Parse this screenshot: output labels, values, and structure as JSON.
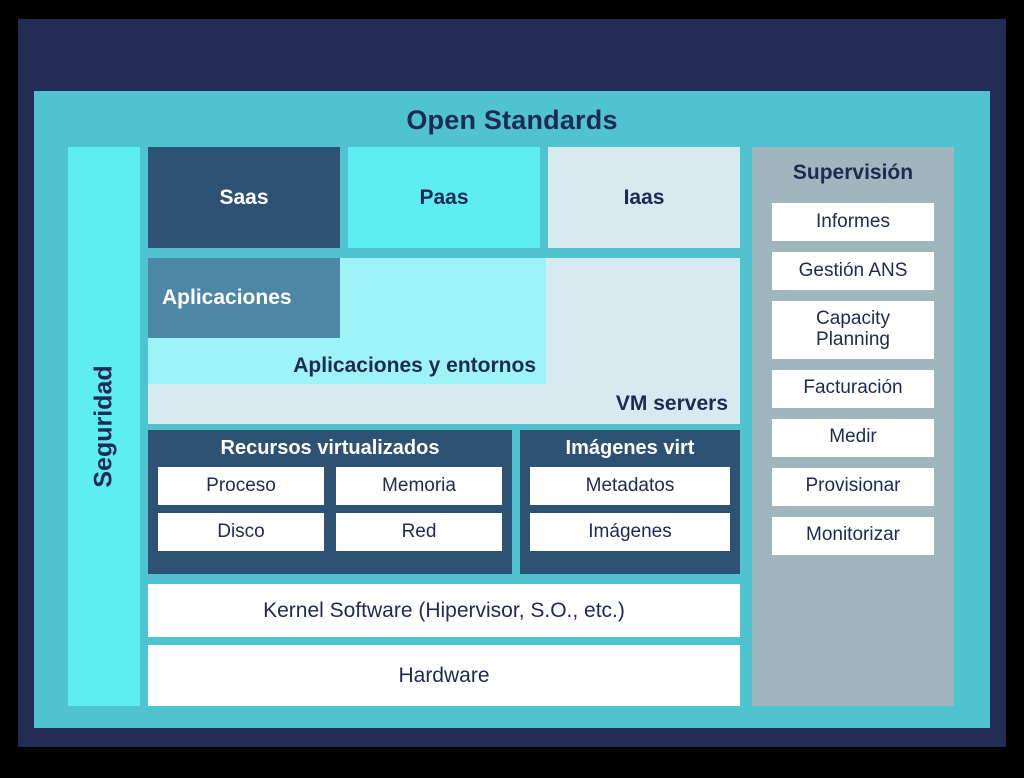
{
  "diagram": {
    "title": "Open Standards",
    "colors": {
      "outer_border": "#000000",
      "frame_navy": "#222c54",
      "panel_teal": "#4fc3cf",
      "bright_cyan": "#5ceef0",
      "pale_cyan": "#9df3f5",
      "light_blue": "#d7eaf0",
      "dark_blue": "#2d5274",
      "steel_blue": "#4d87a6",
      "gray_blue": "#9fb6bc",
      "text_navy": "#1d2a52",
      "white": "#ffffff"
    }
  },
  "security_column": {
    "label": "Seguridad"
  },
  "service_models": [
    {
      "label": "Saas"
    },
    {
      "label": "Paas"
    },
    {
      "label": "Iaas"
    }
  ],
  "app_stack": {
    "applications": "Aplicaciones",
    "environments": "Aplicaciones y entornos",
    "vm_servers": "VM servers"
  },
  "virtualization": {
    "resources": {
      "title": "Recursos virtualizados",
      "items": [
        "Proceso",
        "Memoria",
        "Disco",
        "Red"
      ]
    },
    "images": {
      "title": "Imágenes virt",
      "items": [
        "Metadatos",
        "Imágenes"
      ]
    }
  },
  "base_layers": [
    {
      "label": "Kernel Software (Hipervisor, S.O., etc.)"
    },
    {
      "label": "Hardware"
    }
  ],
  "supervision": {
    "title": "Supervisión",
    "items": [
      {
        "label": "Informes"
      },
      {
        "label": "Gestión ANS"
      },
      {
        "label": "Capacity\nPlanning"
      },
      {
        "label": "Facturación"
      },
      {
        "label": "Medir"
      },
      {
        "label": "Provisionar"
      },
      {
        "label": "Monitorizar"
      }
    ]
  }
}
